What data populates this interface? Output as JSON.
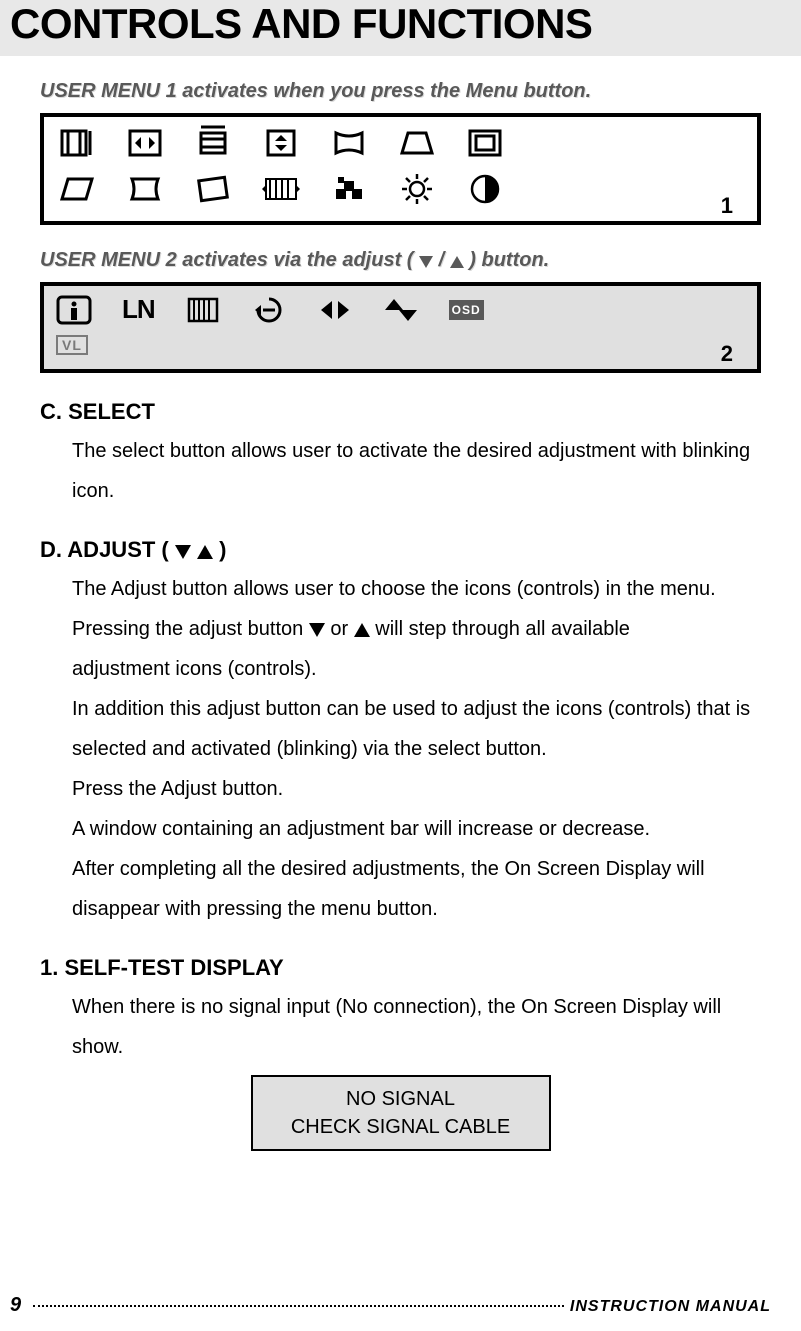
{
  "title": "CONTROLS AND FUNCTIONS",
  "menu1_header": "USER MENU 1 activates when you press the Menu button.",
  "menu1_page": "1",
  "menu2_header_pre": "USER MENU 2 activates via the adjust (",
  "menu2_header_mid": " / ",
  "menu2_header_post": " ) button.",
  "menu2_page": "2",
  "menu2_labels": {
    "ln": "LN",
    "osd": "OSD",
    "vl": "VL"
  },
  "sections": {
    "c_head": "C. SELECT",
    "c_body": "The select button allows user to activate the desired adjustment with blinking icon.",
    "d_head_pre": "D. ADJUST ( ",
    "d_head_post": " )",
    "d_body_1": "The Adjust button allows user to choose the icons (controls) in the menu.",
    "d_body_2a": "Pressing the adjust button ",
    "d_body_2b": " or ",
    "d_body_2c": " will step through all available",
    "d_body_3": "adjustment icons (controls).",
    "d_body_4": "In addition this adjust button can be used to adjust the icons (controls) that is selected and activated (blinking) via the select button.",
    "d_body_5": "Press the Adjust button.",
    "d_body_6": "A window containing an adjustment bar will increase or decrease.",
    "d_body_7": "After completing all the desired adjustments, the On Screen Display will disappear with pressing the menu button.",
    "st_head": "1. SELF-TEST DISPLAY",
    "st_body": "When there is no signal input (No connection), the On Screen Display will show.",
    "no_signal_1": "NO SIGNAL",
    "no_signal_2": "CHECK SIGNAL CABLE"
  },
  "footer": {
    "page": "9",
    "manual": "INSTRUCTION  MANUAL"
  }
}
